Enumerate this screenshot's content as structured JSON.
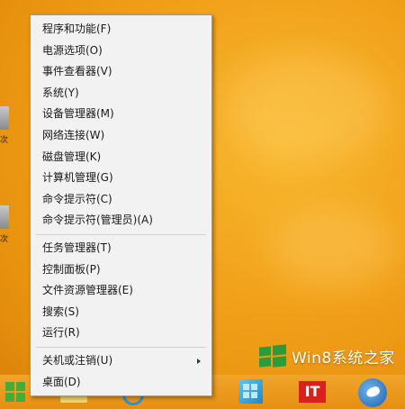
{
  "menu": {
    "groups": [
      [
        {
          "label": "程序和功能(F)"
        },
        {
          "label": "电源选项(O)"
        },
        {
          "label": "事件查看器(V)"
        },
        {
          "label": "系统(Y)"
        },
        {
          "label": "设备管理器(M)"
        },
        {
          "label": "网络连接(W)"
        },
        {
          "label": "磁盘管理(K)"
        },
        {
          "label": "计算机管理(G)"
        },
        {
          "label": "命令提示符(C)"
        },
        {
          "label": "命令提示符(管理员)(A)"
        }
      ],
      [
        {
          "label": "任务管理器(T)"
        },
        {
          "label": "控制面板(P)"
        },
        {
          "label": "文件资源管理器(E)"
        },
        {
          "label": "搜索(S)"
        },
        {
          "label": "运行(R)"
        }
      ],
      [
        {
          "label": "关机或注销(U)",
          "has_submenu": true
        },
        {
          "label": "桌面(D)"
        }
      ]
    ]
  },
  "watermark": {
    "text": "Win8系统之家"
  },
  "desktop": {
    "icon_labels": [
      "次",
      "次"
    ]
  },
  "taskbar": {
    "pinned": [
      {
        "icon": "start-screen-icon"
      },
      {
        "icon": "it-news-icon",
        "text": "IT"
      },
      {
        "icon": "bird-app-icon"
      }
    ]
  },
  "colors": {
    "wallpaper": "#f2a21b",
    "menu_bg": "#f2f2f2",
    "menu_border": "#979797",
    "windows_green": "#3fae3a",
    "it_red": "#d9201c"
  }
}
